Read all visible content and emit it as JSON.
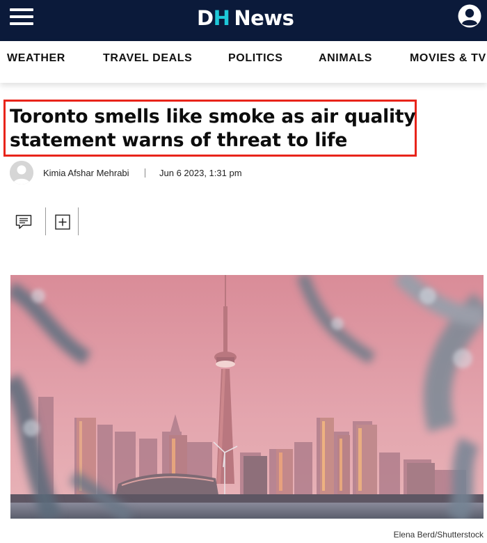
{
  "header": {
    "logo_d": "D",
    "logo_h": "H",
    "logo_news": "News",
    "menu_icon": "hamburger-menu-icon",
    "account_icon": "account-circle-icon",
    "background_color": "#0b1a3a",
    "accent_color": "#1ec8d8"
  },
  "nav": {
    "items": [
      "WEATHER",
      "TRAVEL DEALS",
      "POLITICS",
      "ANIMALS",
      "MOVIES & TV"
    ]
  },
  "article": {
    "headline": "Toronto smells like smoke as air quality statement warns of threat to life",
    "highlight_color": "#e8241a",
    "author": "Kimia Afshar Mehrabi",
    "date": "Jun 6 2023, 1:31 pm",
    "actions": [
      {
        "icon": "comment-icon"
      },
      {
        "icon": "add-to-list-icon"
      }
    ],
    "image": {
      "subject": "toronto-skyline-cn-tower-smoky-pink-sky",
      "credit": "Elena Berd/Shutterstock"
    }
  }
}
